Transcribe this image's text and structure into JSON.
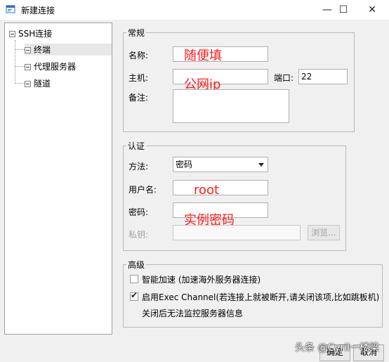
{
  "window": {
    "title": "新建连接",
    "minimize": "—",
    "maximize": "☐",
    "close": "✕"
  },
  "tree": {
    "root": "SSH连接",
    "children": [
      "终端",
      "代理服务器",
      "隧道"
    ]
  },
  "general": {
    "legend": "常规",
    "name_label": "名称:",
    "name_value": "",
    "name_annotation": "随便填",
    "host_label": "主机:",
    "host_value": "",
    "host_annotation": "公网ip",
    "port_label": "端口:",
    "port_value": "22",
    "note_label": "备注:",
    "note_value": ""
  },
  "auth": {
    "legend": "认证",
    "method_label": "方法:",
    "method_value": "密码",
    "user_label": "用户名:",
    "user_value": "",
    "user_annotation": "root",
    "password_label": "密码:",
    "password_value": "",
    "password_annotation": "实例密码",
    "key_label": "私钥:",
    "key_value": "",
    "browse_label": "浏览..."
  },
  "advanced": {
    "legend": "高级",
    "accelerate_label": "智能加速 (加速海外服务器连接)",
    "accelerate_checked": false,
    "exec_label": "启用Exec Channel(若连接上就被断开,请关闭该项,比如跳板机)",
    "exec_checked": true,
    "exec_note": "关闭后无法监控服务器信息"
  },
  "footer": {
    "ok_label": "确定",
    "cancel_label": "取消"
  },
  "watermark": "头条 @Cyril一楼梁"
}
